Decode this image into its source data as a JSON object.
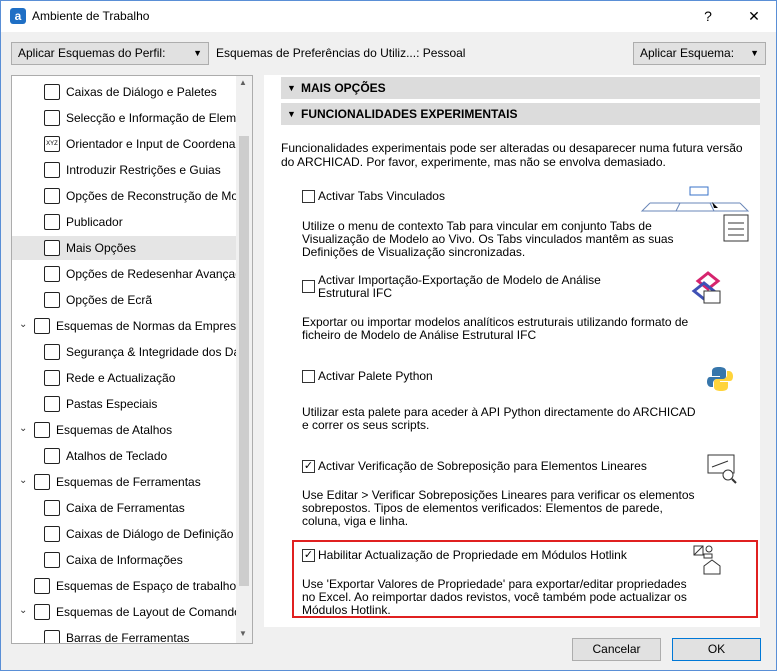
{
  "window": {
    "title": "Ambiente de Trabalho",
    "help": "?",
    "close": "✕"
  },
  "toolbar": {
    "profile_button": "Aplicar Esquemas do Perfil:",
    "scheme_label": "Esquemas de Preferências do Utiliz...: Pessoal",
    "apply_button": "Aplicar Esquema:"
  },
  "tree": [
    {
      "label": "Caixas de Diálogo e Paletes",
      "icon": "dialogs-icon",
      "level": 2
    },
    {
      "label": "Selecção e Informação de Elemen",
      "icon": "selection-info-icon",
      "level": 2
    },
    {
      "label": "Orientador e Input de Coordenad",
      "icon": "tracker-icon",
      "glyph": "XYZ",
      "level": 2
    },
    {
      "label": "Introduzir Restrições e Guias",
      "icon": "constraints-icon",
      "level": 2
    },
    {
      "label": "Opções de Reconstrução de Moc",
      "icon": "rebuild-icon",
      "level": 2
    },
    {
      "label": "Publicador",
      "icon": "publisher-icon",
      "level": 2
    },
    {
      "label": "Mais Opções",
      "icon": "more-options-icon",
      "level": 2,
      "selected": true
    },
    {
      "label": "Opções de Redesenhar Avançada",
      "icon": "redraw-icon",
      "level": 2
    },
    {
      "label": "Opções de Ecrã",
      "icon": "screen-icon",
      "level": 2
    },
    {
      "label": "Esquemas de Normas da Empresa",
      "icon": "company-standards-icon",
      "level": 1,
      "expander": "⌄"
    },
    {
      "label": "Segurança & Integridade dos Da",
      "icon": "security-icon",
      "level": 2
    },
    {
      "label": "Rede e Actualização",
      "icon": "network-icon",
      "level": 2
    },
    {
      "label": "Pastas Especiais",
      "icon": "folders-icon",
      "level": 2
    },
    {
      "label": "Esquemas de Atalhos",
      "icon": "shortcut-schemes-icon",
      "level": 1,
      "expander": "⌄"
    },
    {
      "label": "Atalhos de Teclado",
      "icon": "keyboard-icon",
      "level": 2
    },
    {
      "label": "Esquemas de Ferramentas",
      "icon": "tool-schemes-icon",
      "level": 1,
      "expander": "⌄"
    },
    {
      "label": "Caixa de Ferramentas",
      "icon": "toolbox-icon",
      "level": 2
    },
    {
      "label": "Caixas de Diálogo de Definição d",
      "icon": "settings-dialogs-icon",
      "level": 2
    },
    {
      "label": "Caixa de Informações",
      "icon": "info-box-icon",
      "level": 2
    },
    {
      "label": "Esquemas de Espaço de trabalho",
      "icon": "workspace-schemes-icon",
      "level": 1
    },
    {
      "label": "Esquemas de Layout de Comandos",
      "icon": "command-layout-icon",
      "level": 1,
      "expander": "⌄"
    },
    {
      "label": "Barras de Ferramentas",
      "icon": "toolbars-icon",
      "level": 2
    }
  ],
  "content": {
    "sections": [
      "MAIS OPÇÕES",
      "FUNCIONALIDADES EXPERIMENTAIS"
    ],
    "intro": "Funcionalidades experimentais pode ser alteradas ou desaparecer numa futura versão do ARCHICAD. Por favor, experimente, mas não se envolva demasiado.",
    "features": [
      {
        "label": "Activar Tabs Vinculados",
        "checked": false,
        "desc": "Utilize o menu de contexto Tab para vincular em conjunto Tabs de Visualização de Modelo ao Vivo. Os Tabs vinculados mantêm as suas Definições de Visualização sincronizadas.",
        "icon": "linked-tabs-icon"
      },
      {
        "label": "Activar Importação-Exportação de Modelo de Análise Estrutural IFC",
        "checked": false,
        "desc": "Exportar ou importar modelos analíticos estruturais utilizando formato de ficheiro de Modelo de Análise Estrutural IFC",
        "icon": "ifc-icon"
      },
      {
        "label": "Activar Palete Python",
        "checked": false,
        "desc": "Utilizar esta palete para aceder à API Python directamente do ARCHICAD e correr os seus scripts.",
        "icon": "python-icon"
      },
      {
        "label": "Activar Verificação de Sobreposição para Elementos Lineares",
        "checked": true,
        "desc": "Use Editar > Verificar Sobreposições Lineares para verificar os elementos sobrepostos. Tipos de elementos verificados: Elementos de parede, coluna, viga e linha.",
        "icon": "overlap-check-icon"
      },
      {
        "label": "Habilitar Actualização de Propriedade em Módulos Hotlink",
        "checked": true,
        "desc": "Use 'Exportar Valores de Propriedade' para exportar/editar propriedades no Excel. Ao reimportar dados revistos, você também pode actualizar os Módulos Hotlink.",
        "icon": "hotlink-property-icon"
      }
    ]
  },
  "footer": {
    "cancel": "Cancelar",
    "ok": "OK"
  },
  "colors": {
    "highlight_border": "#e02020",
    "selected_row": "#e5e5e5",
    "section_header": "#dcdcdc"
  }
}
